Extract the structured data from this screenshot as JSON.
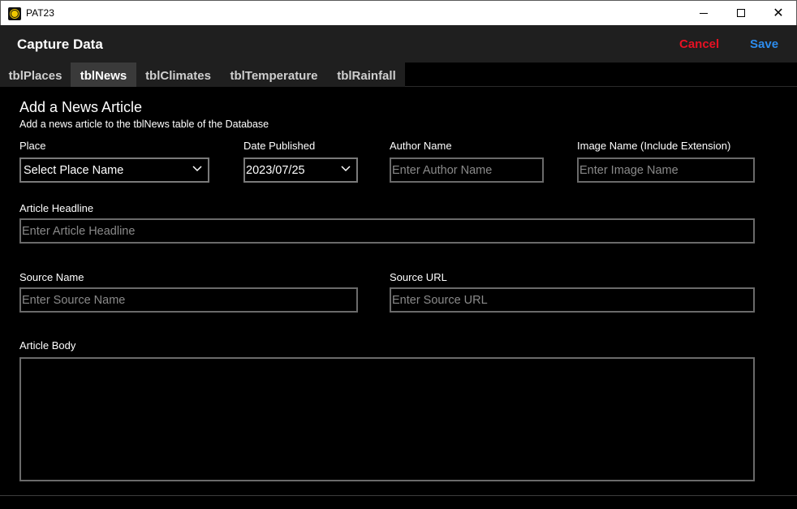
{
  "window": {
    "title": "PAT23",
    "minimize_glyph": "minimize",
    "maximize_glyph": "maximize",
    "close_glyph": "✕"
  },
  "header": {
    "title": "Capture Data",
    "cancel_label": "Cancel",
    "save_label": "Save",
    "cancel_color": "#e81123",
    "save_color": "#2d8ced"
  },
  "tabs": [
    {
      "label": "tblPlaces",
      "active": false
    },
    {
      "label": "tblNews",
      "active": true
    },
    {
      "label": "tblClimates",
      "active": false
    },
    {
      "label": "tblTemperature",
      "active": false
    },
    {
      "label": "tblRainfall",
      "active": false
    }
  ],
  "form": {
    "title": "Add a News Article",
    "description": "Add a news article to the tblNews table of the Database",
    "place": {
      "label": "Place",
      "value": "Select Place Name"
    },
    "date_published": {
      "label": "Date Published",
      "value": "2023/07/25"
    },
    "author": {
      "label": "Author Name",
      "placeholder": "Enter Author Name"
    },
    "image": {
      "label": "Image Name (Include Extension)",
      "placeholder": "Enter Image Name"
    },
    "headline": {
      "label": "Article Headline",
      "placeholder": "Enter Article Headline"
    },
    "source_name": {
      "label": "Source Name",
      "placeholder": "Enter Source Name"
    },
    "source_url": {
      "label": "Source URL",
      "placeholder": "Enter Source URL"
    },
    "body": {
      "label": "Article Body",
      "value": ""
    }
  }
}
